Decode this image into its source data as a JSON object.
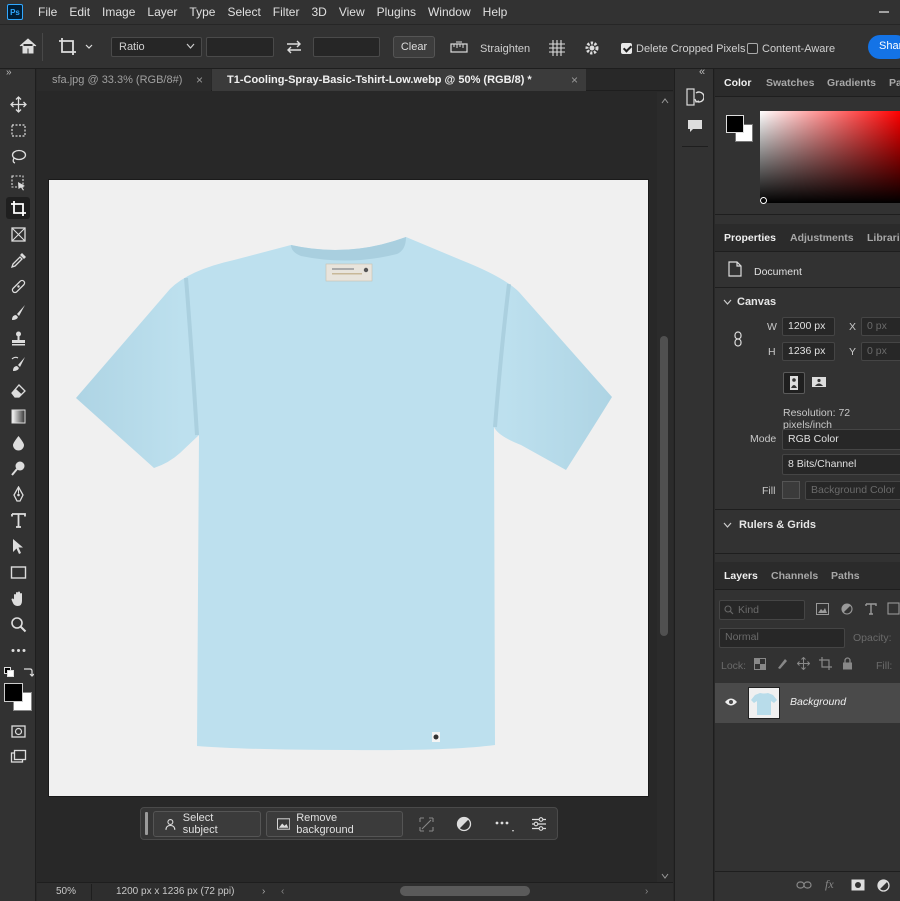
{
  "menu": [
    "File",
    "Edit",
    "Image",
    "Layer",
    "Type",
    "Select",
    "Filter",
    "3D",
    "View",
    "Plugins",
    "Window",
    "Help"
  ],
  "app_logo": "Ps",
  "options": {
    "ratio_label": "Ratio",
    "clear_label": "Clear",
    "straighten_label": "Straighten",
    "delete_cropped_label": "Delete Cropped Pixels",
    "delete_cropped_checked": true,
    "content_aware_label": "Content-Aware",
    "content_aware_checked": false,
    "share_label": "Shar"
  },
  "tabs": [
    {
      "label": "sfa.jpg @ 33.3% (RGB/8#)",
      "active": false
    },
    {
      "label": "T1-Cooling-Spray-Basic-Tshirt-Low.webp @ 50% (RGB/8) *",
      "active": true
    }
  ],
  "canvas": {
    "shirt_color": "#b8dcea",
    "background_color": "#f0f0f0"
  },
  "taskbar": {
    "select_subject": "Select subject",
    "remove_background": "Remove background"
  },
  "status": {
    "zoom": "50%",
    "doc_info": "1200 px x 1236 px (72 ppi)"
  },
  "color_panel": {
    "tabs": [
      "Color",
      "Swatches",
      "Gradients",
      "Pa"
    ],
    "foreground": "#000000",
    "background": "#ffffff"
  },
  "properties": {
    "tabs": [
      "Properties",
      "Adjustments",
      "Librarie"
    ],
    "doc_label": "Document",
    "canvas_title": "Canvas",
    "w_label": "W",
    "w_value": "1200 px",
    "h_label": "H",
    "h_value": "1236 px",
    "x_label": "X",
    "x_value": "0 px",
    "y_label": "Y",
    "y_value": "0 px",
    "resolution": "Resolution: 72 pixels/inch",
    "mode_label": "Mode",
    "mode_value": "RGB Color",
    "bits_value": "8 Bits/Channel",
    "fill_label": "Fill",
    "fill_value": "Background Color",
    "rulers_title": "Rulers & Grids"
  },
  "layers_panel": {
    "tabs": [
      "Layers",
      "Channels",
      "Paths"
    ],
    "kind_label": "Kind",
    "blend_mode": "Normal",
    "opacity_label": "Opacity:",
    "lock_label": "Lock:",
    "fill_label": "Fill:",
    "layer_name": "Background"
  }
}
